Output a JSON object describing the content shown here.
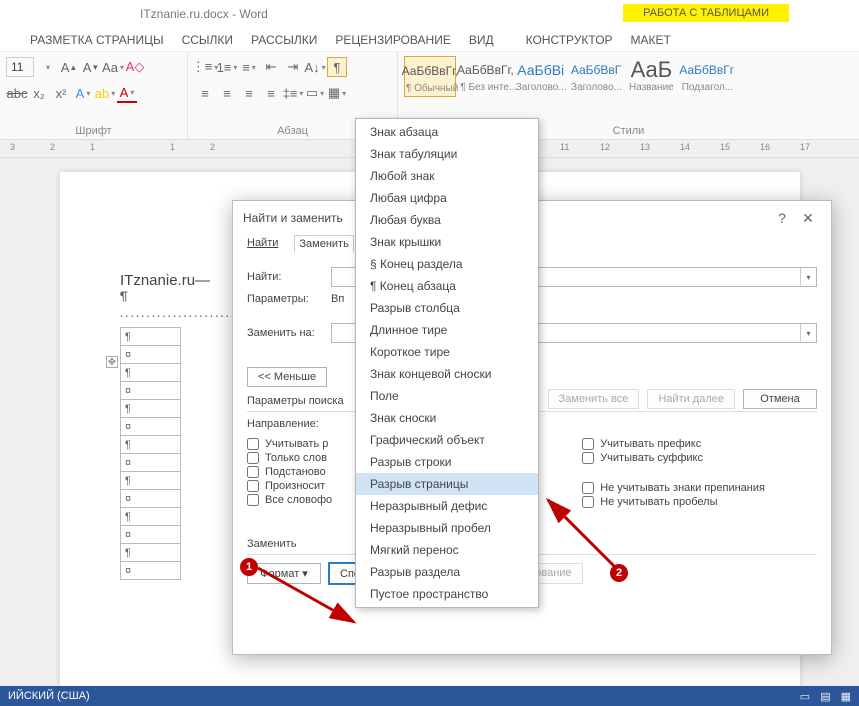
{
  "title": "ITznanie.ru.docx - Word",
  "tableTools": "РАБОТА С ТАБЛИЦАМИ",
  "ribbonTabs": [
    "РАЗМЕТКА СТРАНИЦЫ",
    "ССЫЛКИ",
    "РАССЫЛКИ",
    "РЕЦЕНЗИРОВАНИЕ",
    "ВИД",
    "КОНСТРУКТОР",
    "МАКЕТ"
  ],
  "fontSize": "11",
  "groupLabels": {
    "font": "Шрифт",
    "para": "Абзац",
    "styles": "Стили"
  },
  "styles": [
    {
      "preview": "АаБбВвГг,",
      "label": "¶ Обычный",
      "sel": true
    },
    {
      "preview": "АаБбВвГг,",
      "label": "¶ Без инте..."
    },
    {
      "preview": "АаБбВі",
      "label": "Заголово...",
      "blue": true
    },
    {
      "preview": "АаБбВвГ",
      "label": "Заголово...",
      "blue": true
    },
    {
      "preview": "АаБ",
      "label": "Название",
      "big": true
    },
    {
      "preview": "АаБбВвГг",
      "label": "Подзагол...",
      "blue": true
    }
  ],
  "rulerMarks": [
    "3",
    "2",
    "1",
    "1",
    "2",
    "11",
    "12",
    "13",
    "14",
    "15",
    "16",
    "17"
  ],
  "doc": {
    "heading": "ITznanie.ru",
    "pilcrow": "¶",
    "cellMark": "¤"
  },
  "dialog": {
    "title": "Найти и заменить",
    "tabs": [
      "Найти",
      "Заменить"
    ],
    "findLabel": "Найти:",
    "paramsLabel": "Параметры:",
    "paramsValue": "Вп",
    "replaceLabel": "Заменить на:",
    "lessBtn": "<< Меньше",
    "searchParams": "Параметры поиска",
    "direction": "Направление:",
    "chkLeft": [
      "Учитывать р",
      "Только слов",
      "Подстаново",
      "Произносит",
      "Все словофо"
    ],
    "chkRightTop": [
      "Учитывать префикс",
      "Учитывать суффикс"
    ],
    "chkRightBottom": [
      "Не учитывать знаки препинания",
      "Не учитывать пробелы"
    ],
    "replaceSection": "Заменить",
    "formatBtn": "Формат",
    "specialBtn": "Специальный",
    "clearFmtBtn": "Снять форматирование",
    "replaceAllBtn": "Заменить все",
    "findNextBtn": "Найти далее",
    "cancelBtn": "Отмена"
  },
  "menu": {
    "items": [
      "Знак абзаца",
      "Знак табуляции",
      "Любой знак",
      "Любая цифра",
      "Любая буква",
      "Знак крышки",
      "§ Конец раздела",
      "¶ Конец абзаца",
      "Разрыв столбца",
      "Длинное тире",
      "Короткое тире",
      "Знак концевой сноски",
      "Поле",
      "Знак сноски",
      "Графический объект",
      "Разрыв строки",
      "Разрыв страницы",
      "Неразрывный дефис",
      "Неразрывный пробел",
      "Мягкий перенос",
      "Разрыв раздела",
      "Пустое пространство"
    ],
    "hlIndex": 16
  },
  "status": {
    "lang": "ИЙСКИЙ (США)"
  },
  "annot": {
    "n1": "1",
    "n2": "2"
  }
}
